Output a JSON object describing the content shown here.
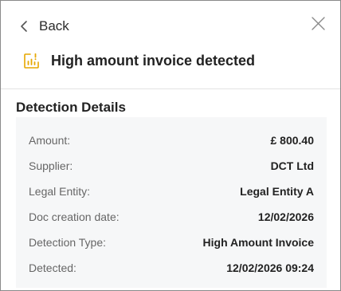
{
  "header": {
    "back_label": "Back",
    "title": "High amount invoice detected",
    "title_icon": "chart-alert-icon",
    "accent_color": "#e6a700"
  },
  "section": {
    "title": "Detection Details"
  },
  "details": {
    "rows": [
      {
        "label": "Amount:",
        "value": "£ 800.40"
      },
      {
        "label": "Supplier:",
        "value": "DCT Ltd"
      },
      {
        "label": "Legal Entity:",
        "value": "Legal Entity A"
      },
      {
        "label": "Doc creation date:",
        "value": "12/02/2026"
      },
      {
        "label": "Detection Type:",
        "value": "High Amount Invoice"
      },
      {
        "label": "Detected:",
        "value": "12/02/2026 09:24"
      }
    ]
  }
}
